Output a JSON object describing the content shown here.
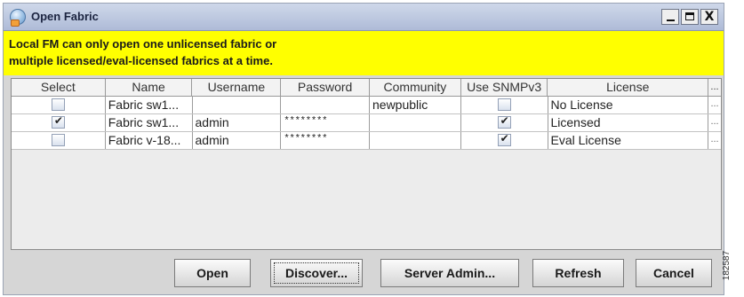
{
  "window": {
    "title": "Open Fabric",
    "controls": {
      "minimize": "_",
      "maximize": "□",
      "close": "X"
    }
  },
  "banner": {
    "line1": "Local FM can only open one unlicensed fabric or",
    "line2": "multiple licensed/eval-licensed fabrics at a time."
  },
  "table": {
    "columns": {
      "select": "Select",
      "name": "Name",
      "username": "Username",
      "password": "Password",
      "community": "Community",
      "snmpv3": "Use SNMPv3",
      "license": "License",
      "more": "..."
    },
    "rows": [
      {
        "select": false,
        "name": "Fabric sw1...",
        "username": "",
        "password": "",
        "community": "newpublic",
        "snmpv3": false,
        "license": "No License",
        "more": "..."
      },
      {
        "select": true,
        "name": "Fabric sw1...",
        "username": "admin",
        "password": "********",
        "community": "",
        "snmpv3": true,
        "license": "Licensed",
        "more": "..."
      },
      {
        "select": false,
        "name": "Fabric v-18...",
        "username": "admin",
        "password": "********",
        "community": "",
        "snmpv3": true,
        "license": "Eval License",
        "more": "..."
      }
    ]
  },
  "buttons": {
    "open": "Open",
    "discover": "Discover...",
    "server_admin": "Server Admin...",
    "refresh": "Refresh",
    "cancel": "Cancel"
  },
  "watermark": "182587",
  "colors": {
    "banner": "#ffff00",
    "titlebar": "#aebbd7",
    "dialog": "#d6d6d6"
  }
}
